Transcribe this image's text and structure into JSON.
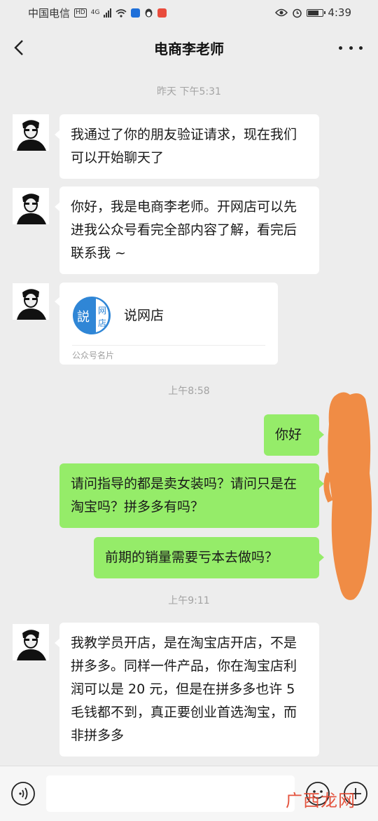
{
  "status_bar": {
    "carrier": "中国电信",
    "hd_badge": "HD",
    "network": "4G",
    "time": "4:39",
    "battery_percent": 80
  },
  "header": {
    "title": "电商李老师"
  },
  "messages": {
    "ts1": "昨天 下午5:31",
    "m1": "我通过了你的朋友验证请求，现在我们可以开始聊天了",
    "m2": "你好，我是电商李老师。开网店可以先进我公众号看完全部内容了解，看完后联系我 ~",
    "card": {
      "name": "说网店",
      "label": "公众号名片",
      "logo_chars": [
        "説",
        "网",
        "店"
      ]
    },
    "ts2": "上午8:58",
    "m3": "你好",
    "m4": "请问指导的都是卖女装吗？请问只是在淘宝吗？拼多多有吗？",
    "m5": "前期的销量需要亏本去做吗？",
    "ts3": "上午9:11",
    "m6": "我教学员开店，是在淘宝店开店，不是拼多多。同样一件产品，你在淘宝店利润可以是 20 元，但是在拼多多也许 5 毛钱都不到，真正要创业首选淘宝，而非拼多多"
  },
  "input_bar": {
    "icons": [
      "voice-icon",
      "emoji-icon",
      "plus-icon"
    ]
  },
  "watermark": "广西龙网",
  "colors": {
    "background": "#ededed",
    "incoming_bubble": "#ffffff",
    "outgoing_bubble": "#95ec69",
    "timestamp": "#a3a3a3",
    "scribble": "#f08c45",
    "logo_blue": "#2f86d6"
  }
}
